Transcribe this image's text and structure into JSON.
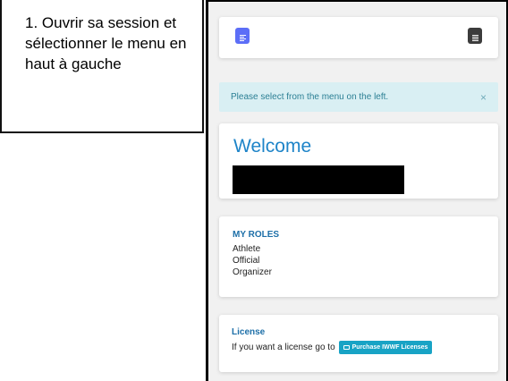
{
  "caption": {
    "text": "1. Ouvrir sa session et sélectionner le menu en haut à gauche"
  },
  "colors": {
    "left_menu_button": "#5c6ef7",
    "right_menu_button": "#3c3c3c",
    "alert_bg": "#d9eff3",
    "alert_text": "#2b7f94",
    "welcome_title": "#1e84c8",
    "section_title": "#1d6fa8",
    "license_button": "#18a3c5"
  },
  "icons": {
    "left_menu": "list-icon",
    "right_menu": "menu-icon",
    "alert_close": "close-icon",
    "license_button": "card-icon"
  },
  "alert": {
    "message": "Please select from the menu on the left.",
    "close": "×"
  },
  "welcome": {
    "title": "Welcome"
  },
  "roles": {
    "title": "MY ROLES",
    "items": [
      "Athlete",
      "Official",
      "Organizer"
    ]
  },
  "license": {
    "title": "License",
    "text": "If you want a license go to",
    "button_label": "Purchase IWWF Licenses"
  }
}
